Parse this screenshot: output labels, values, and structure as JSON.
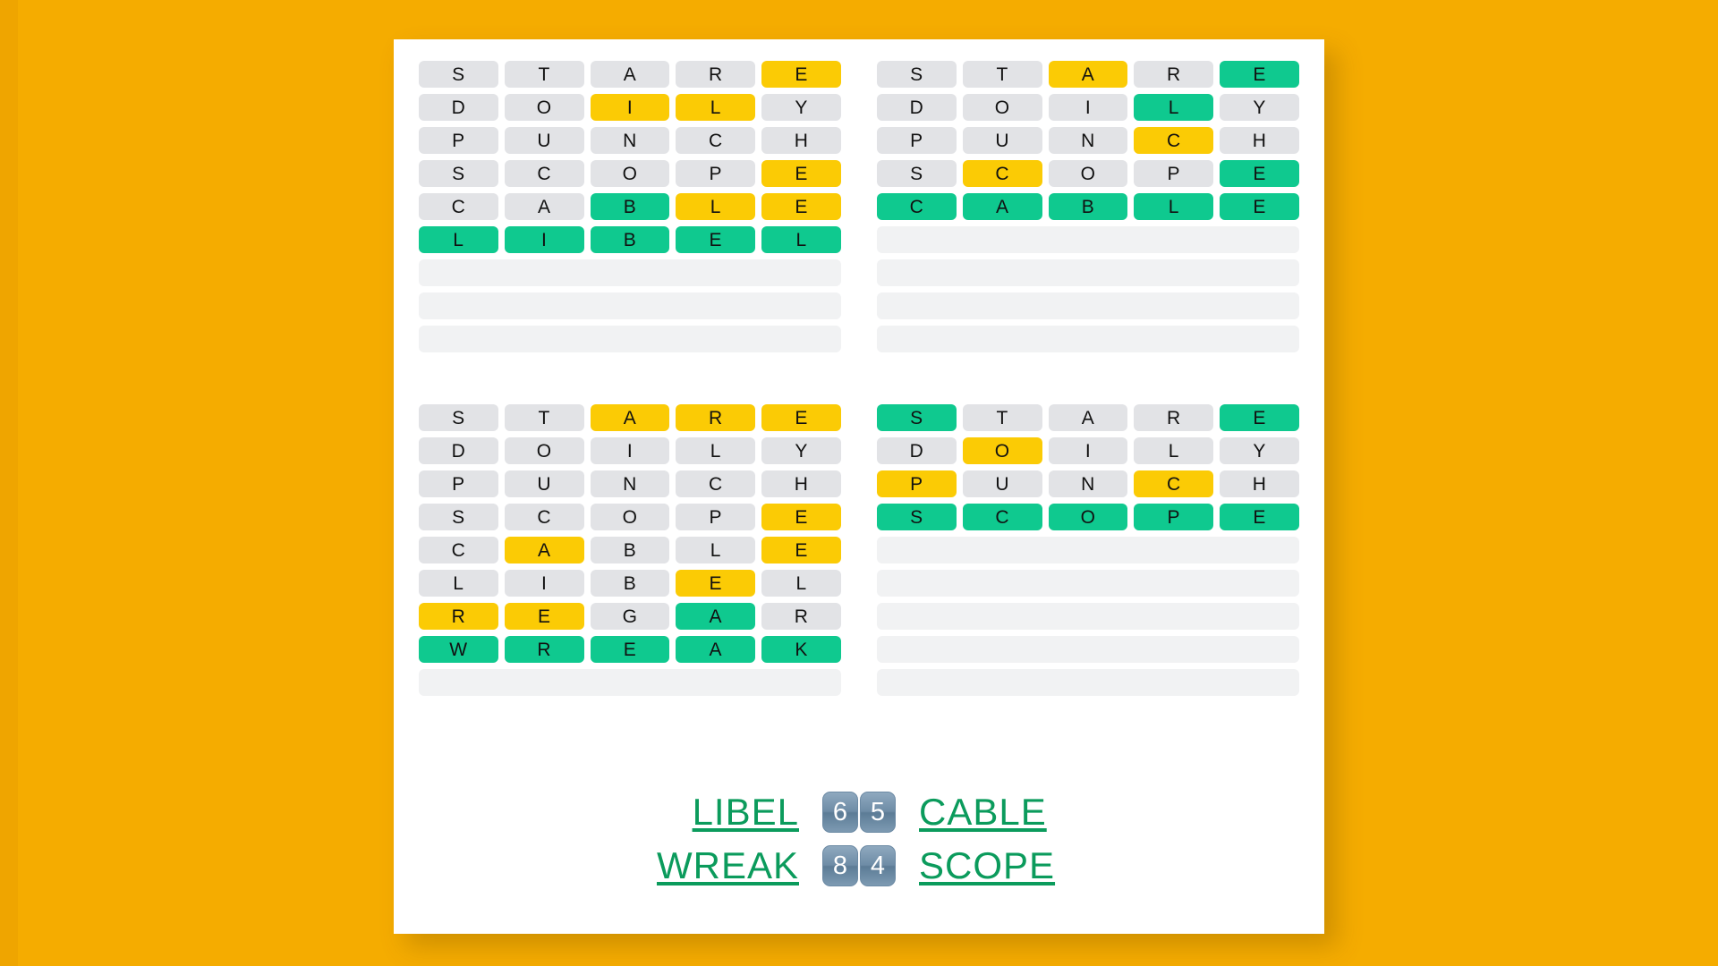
{
  "colors": {
    "page_background": "#F5AC00",
    "card_background": "#FFFFFF",
    "tile_gray": "#E2E3E6",
    "tile_yellow": "#FBCB05",
    "tile_green": "#0FC98F",
    "tile_blank": "#F1F2F3",
    "answer_text": "#0B9B5C",
    "count_chip": "#6E8CA6"
  },
  "board": {
    "quadrants": [
      {
        "name": "quadrant-top-left",
        "solution": "LIBEL",
        "guesses_used": 6,
        "total_rows": 9,
        "rows": [
          {
            "letters": [
              "S",
              "T",
              "A",
              "R",
              "E"
            ],
            "states": [
              "gray",
              "gray",
              "gray",
              "gray",
              "yellow"
            ]
          },
          {
            "letters": [
              "D",
              "O",
              "I",
              "L",
              "Y"
            ],
            "states": [
              "gray",
              "gray",
              "yellow",
              "yellow",
              "gray"
            ]
          },
          {
            "letters": [
              "P",
              "U",
              "N",
              "C",
              "H"
            ],
            "states": [
              "gray",
              "gray",
              "gray",
              "gray",
              "gray"
            ]
          },
          {
            "letters": [
              "S",
              "C",
              "O",
              "P",
              "E"
            ],
            "states": [
              "gray",
              "gray",
              "gray",
              "gray",
              "yellow"
            ]
          },
          {
            "letters": [
              "C",
              "A",
              "B",
              "L",
              "E"
            ],
            "states": [
              "gray",
              "gray",
              "green",
              "yellow",
              "yellow"
            ]
          },
          {
            "letters": [
              "L",
              "I",
              "B",
              "E",
              "L"
            ],
            "states": [
              "green",
              "green",
              "green",
              "green",
              "green"
            ]
          }
        ],
        "empty_rows": 3
      },
      {
        "name": "quadrant-top-right",
        "solution": "CABLE",
        "guesses_used": 5,
        "total_rows": 9,
        "rows": [
          {
            "letters": [
              "S",
              "T",
              "A",
              "R",
              "E"
            ],
            "states": [
              "gray",
              "gray",
              "yellow",
              "gray",
              "green"
            ]
          },
          {
            "letters": [
              "D",
              "O",
              "I",
              "L",
              "Y"
            ],
            "states": [
              "gray",
              "gray",
              "gray",
              "green",
              "gray"
            ]
          },
          {
            "letters": [
              "P",
              "U",
              "N",
              "C",
              "H"
            ],
            "states": [
              "gray",
              "gray",
              "gray",
              "yellow",
              "gray"
            ]
          },
          {
            "letters": [
              "S",
              "C",
              "O",
              "P",
              "E"
            ],
            "states": [
              "gray",
              "yellow",
              "gray",
              "gray",
              "green"
            ]
          },
          {
            "letters": [
              "C",
              "A",
              "B",
              "L",
              "E"
            ],
            "states": [
              "green",
              "green",
              "green",
              "green",
              "green"
            ]
          }
        ],
        "empty_rows": 4
      },
      {
        "name": "quadrant-bottom-left",
        "solution": "WREAK",
        "guesses_used": 8,
        "total_rows": 9,
        "rows": [
          {
            "letters": [
              "S",
              "T",
              "A",
              "R",
              "E"
            ],
            "states": [
              "gray",
              "gray",
              "yellow",
              "yellow",
              "yellow"
            ]
          },
          {
            "letters": [
              "D",
              "O",
              "I",
              "L",
              "Y"
            ],
            "states": [
              "gray",
              "gray",
              "gray",
              "gray",
              "gray"
            ]
          },
          {
            "letters": [
              "P",
              "U",
              "N",
              "C",
              "H"
            ],
            "states": [
              "gray",
              "gray",
              "gray",
              "gray",
              "gray"
            ]
          },
          {
            "letters": [
              "S",
              "C",
              "O",
              "P",
              "E"
            ],
            "states": [
              "gray",
              "gray",
              "gray",
              "gray",
              "yellow"
            ]
          },
          {
            "letters": [
              "C",
              "A",
              "B",
              "L",
              "E"
            ],
            "states": [
              "gray",
              "yellow",
              "gray",
              "gray",
              "yellow"
            ]
          },
          {
            "letters": [
              "L",
              "I",
              "B",
              "E",
              "L"
            ],
            "states": [
              "gray",
              "gray",
              "gray",
              "yellow",
              "gray"
            ]
          },
          {
            "letters": [
              "R",
              "E",
              "G",
              "A",
              "R"
            ],
            "states": [
              "yellow",
              "yellow",
              "gray",
              "green",
              "gray"
            ]
          },
          {
            "letters": [
              "W",
              "R",
              "E",
              "A",
              "K"
            ],
            "states": [
              "green",
              "green",
              "green",
              "green",
              "green"
            ]
          }
        ],
        "empty_rows": 1
      },
      {
        "name": "quadrant-bottom-right",
        "solution": "SCOPE",
        "guesses_used": 4,
        "total_rows": 9,
        "rows": [
          {
            "letters": [
              "S",
              "T",
              "A",
              "R",
              "E"
            ],
            "states": [
              "green",
              "gray",
              "gray",
              "gray",
              "green"
            ]
          },
          {
            "letters": [
              "D",
              "O",
              "I",
              "L",
              "Y"
            ],
            "states": [
              "gray",
              "yellow",
              "gray",
              "gray",
              "gray"
            ]
          },
          {
            "letters": [
              "P",
              "U",
              "N",
              "C",
              "H"
            ],
            "states": [
              "yellow",
              "gray",
              "gray",
              "yellow",
              "gray"
            ]
          },
          {
            "letters": [
              "S",
              "C",
              "O",
              "P",
              "E"
            ],
            "states": [
              "green",
              "green",
              "green",
              "green",
              "green"
            ]
          }
        ],
        "empty_rows": 5
      }
    ]
  },
  "answers": {
    "line1": {
      "left_word": "LIBEL",
      "left_count": "6",
      "right_count": "5",
      "right_word": "CABLE"
    },
    "line2": {
      "left_word": "WREAK",
      "left_count": "8",
      "right_count": "4",
      "right_word": "SCOPE"
    }
  }
}
